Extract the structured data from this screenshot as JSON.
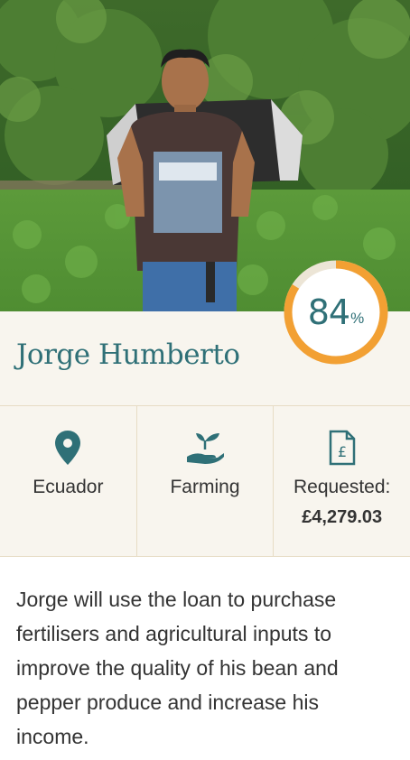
{
  "borrower": {
    "name": "Jorge Humberto"
  },
  "progress": {
    "value": 84,
    "number": "84",
    "suffix": "%"
  },
  "stats": {
    "location": {
      "icon": "location-pin-icon",
      "label": "Ecuador"
    },
    "sector": {
      "icon": "plant-in-hand-icon",
      "label": "Farming"
    },
    "requested": {
      "icon": "pound-document-icon",
      "label": "Requested:",
      "amount": "£4,279.03"
    }
  },
  "description": "Jorge will use the loan to purchase fertilisers and agricultural inputs to improve the quality of his bean and pepper produce and increase his income.",
  "colors": {
    "teal": "#2f7077",
    "orange": "#f2a033",
    "ring_track": "#ece5d6",
    "band": "#f8f5ee"
  }
}
